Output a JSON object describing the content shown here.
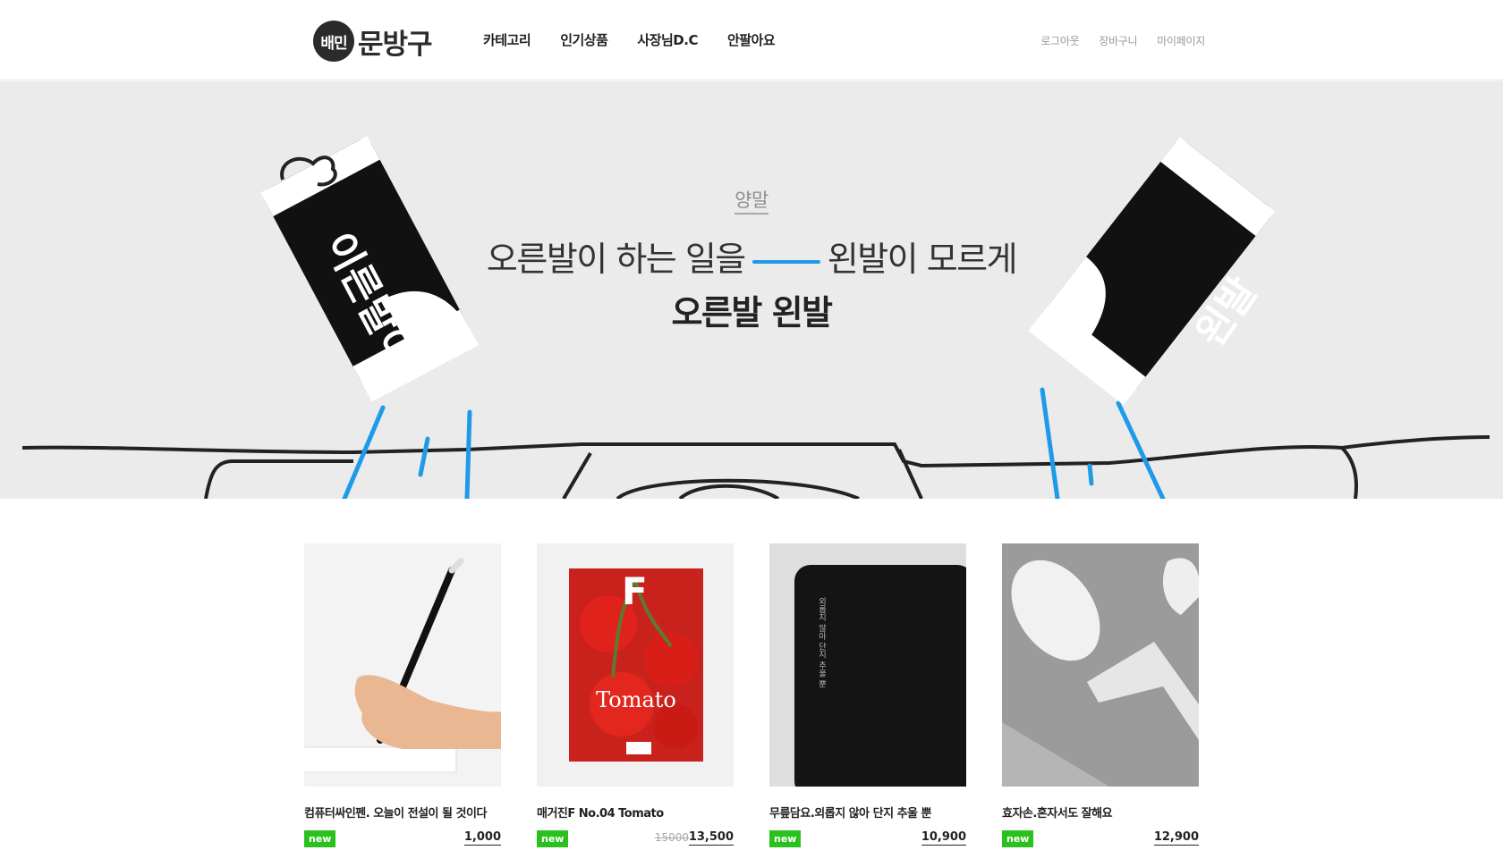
{
  "header": {
    "logo_badge": "배민",
    "logo_text": "문방구",
    "nav": [
      "카테고리",
      "인기상품",
      "사장님D.C",
      "안팔아요"
    ],
    "util": [
      "로그아웃",
      "장바구니",
      "마이페이지"
    ]
  },
  "hero": {
    "category": "양말",
    "subtitle_left": "오른발이 하는 일을",
    "subtitle_right": "왼발이 모르게",
    "title": "오른발 왼발",
    "left_sock_text": "이른발이",
    "right_sock_text": "왼발",
    "accent_color": "#1e9be8"
  },
  "products": [
    {
      "name": "컴퓨터싸인펜. 오늘이 전설이 될 것이다",
      "badge": "new",
      "price": "1,000",
      "old_price": ""
    },
    {
      "name": "매거진F No.04 Tomato",
      "badge": "new",
      "price": "13,500",
      "old_price": "15000",
      "cover_text": "Tomato",
      "cover_letter": "F"
    },
    {
      "name": "무릎담요.외롭지 않아 단지 추울 뿐",
      "badge": "new",
      "price": "10,900",
      "old_price": "",
      "blanket_text": "외롭지 않아 단지 추울 뿐"
    },
    {
      "name": "효자손.혼자서도 잘해요",
      "badge": "new",
      "price": "12,900",
      "old_price": ""
    }
  ],
  "colors": {
    "badge_green": "#2ac11e",
    "hero_bg": "#ebebeb"
  }
}
